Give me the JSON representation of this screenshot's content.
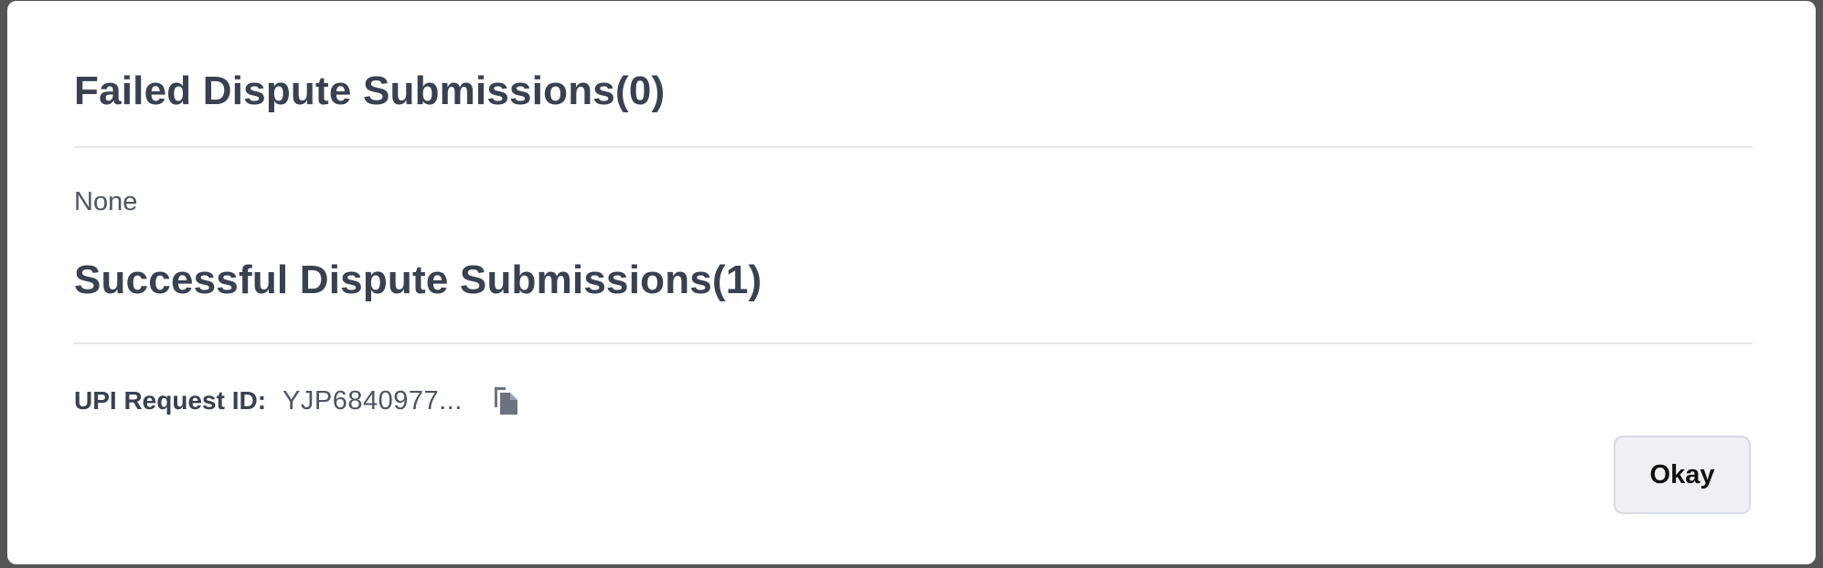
{
  "dialog": {
    "failed": {
      "title": "Failed Dispute Submissions(0)",
      "empty_text": "None"
    },
    "successful": {
      "title": "Successful Dispute Submissions(1)",
      "items": [
        {
          "label": "UPI Request ID:",
          "value": "YJP6840977...",
          "action_icon": "copy-icon"
        }
      ]
    },
    "okay_label": "Okay"
  },
  "colors": {
    "heading": "#374151",
    "body_text": "#4b5563",
    "divider": "#e5e7eb",
    "icon": "#6b7280",
    "button_bg": "#eef0f3",
    "button_border": "#d8dbe2",
    "backdrop": "#555555"
  }
}
